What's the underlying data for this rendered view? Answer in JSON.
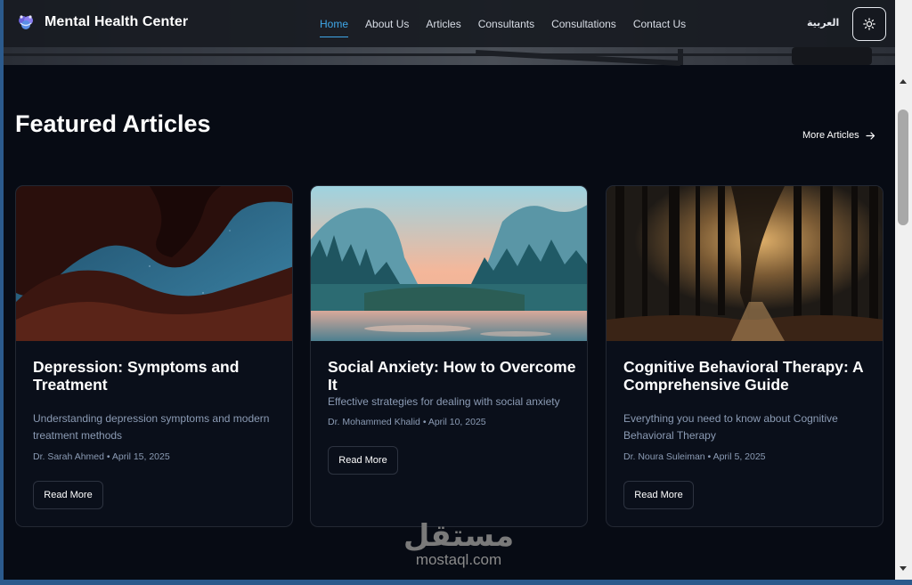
{
  "header": {
    "brand_title": "Mental Health Center",
    "brand_icon": "brain-icon",
    "nav": [
      {
        "label": "Home",
        "active": true
      },
      {
        "label": "About Us",
        "active": false
      },
      {
        "label": "Articles",
        "active": false
      },
      {
        "label": "Consultants",
        "active": false
      },
      {
        "label": "Consultations",
        "active": false
      },
      {
        "label": "Contact Us",
        "active": false
      }
    ],
    "language_label": "العربية",
    "theme_icon": "sun-icon"
  },
  "featured": {
    "title": "Featured Articles",
    "more_label": "More Articles",
    "more_icon": "arrow-right-icon",
    "articles": [
      {
        "title": "Depression: Symptoms and Treatment",
        "description": "Understanding depression symptoms and modern treatment methods",
        "author": "Dr. Sarah Ahmed",
        "date": "April 15, 2025",
        "button": "Read More"
      },
      {
        "title": "Social Anxiety: How to Overcome It",
        "description": "Effective strategies for dealing with social anxiety",
        "author": "Dr. Mohammed Khalid",
        "date": "April 10, 2025",
        "button": "Read More"
      },
      {
        "title": "Cognitive Behavioral Therapy: A Comprehensive Guide",
        "description": "Everything you need to know about Cognitive Behavioral Therapy",
        "author": "Dr. Noura Suleiman",
        "date": "April 5, 2025",
        "button": "Read More"
      }
    ]
  },
  "watermark": {
    "arabic": "مستقل",
    "latin": "mostaql.com"
  },
  "colors": {
    "accent": "#3fa7e8",
    "background": "#070b14",
    "card_border": "#232833",
    "muted_text": "#8b9bb4"
  }
}
